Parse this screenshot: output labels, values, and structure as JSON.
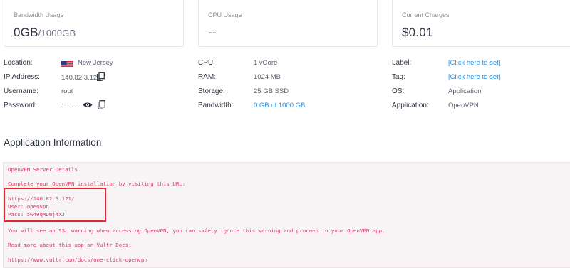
{
  "cards": [
    {
      "title": "Bandwidth Usage",
      "value": "0GB",
      "sub": "/1000GB"
    },
    {
      "title": "CPU Usage",
      "value": "--",
      "sub": ""
    },
    {
      "title": "Current Charges",
      "value": "$0.01",
      "sub": ""
    }
  ],
  "details": {
    "location_label": "Location:",
    "location_value": "New Jersey",
    "ip_label": "IP Address:",
    "ip_value": "140.82.3.121",
    "username_label": "Username:",
    "username_value": "root",
    "password_label": "Password:",
    "password_value": "·······",
    "cpu_label": "CPU:",
    "cpu_value": "1 vCore",
    "ram_label": "RAM:",
    "ram_value": "1024 MB",
    "storage_label": "Storage:",
    "storage_value": "25 GB SSD",
    "bandwidth_label": "Bandwidth:",
    "bandwidth_value": "0 GB of 1000 GB",
    "label_label": "Label:",
    "label_value": "[Click here to set]",
    "tag_label": "Tag:",
    "tag_value": "[Click here to set]",
    "os_label": "OS:",
    "os_value": "Application",
    "app_label": "Application:",
    "app_value": "OpenVPN"
  },
  "app_info": {
    "title": "Application Information",
    "lines": [
      "OpenVPN Server Details",
      "Complete your OpenVPN installation by visiting this URL:",
      "https://140.82.3.121/",
      "User: openvpn",
      "Pass: 5w49qMDWj4XJ",
      "You will see an SSL warning when accessing OpenVPN, you can safely ignore this warning and proceed to your OpenVPN app.",
      "Read more about this app on Vultr Docs:",
      "https://www.vultr.com/docs/one-click-openvpn"
    ]
  },
  "icons": [
    "us-flag-icon",
    "copy-icon",
    "eye-icon",
    "copy-icon"
  ],
  "colors": {
    "link": "#2f8ed8",
    "code_text": "#d63d6a",
    "code_bg": "#f8f3f4",
    "highlight": "#e1252e"
  }
}
